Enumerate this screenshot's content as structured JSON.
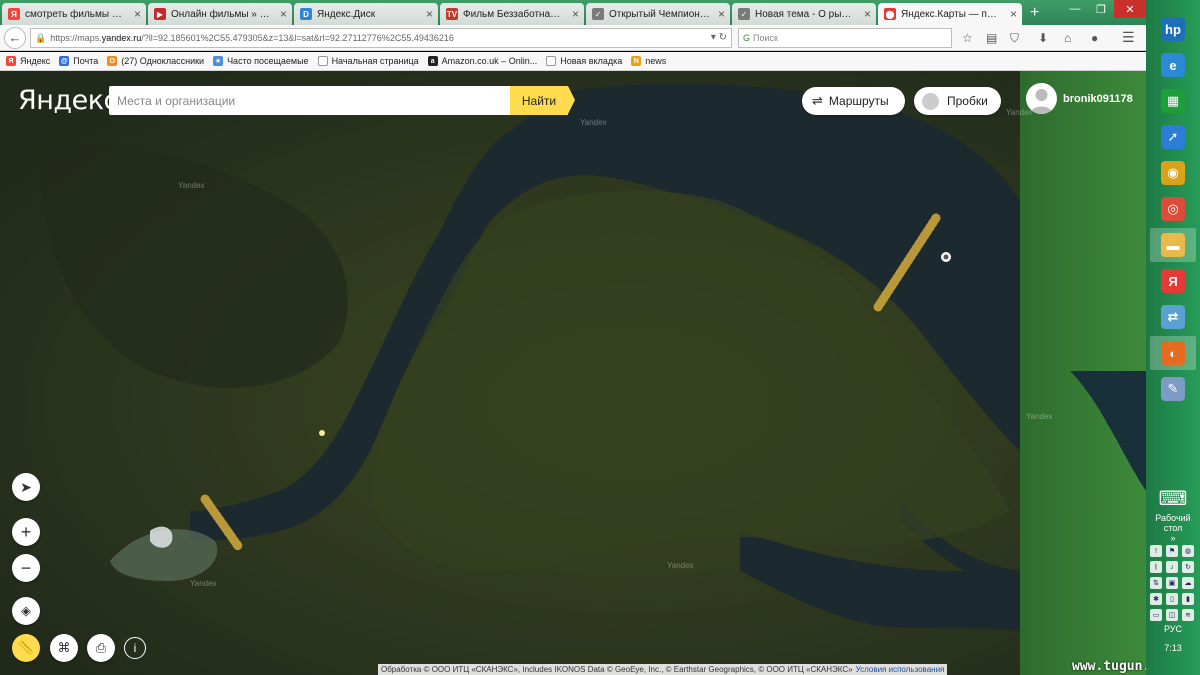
{
  "browser": {
    "tabs": [
      {
        "title": "смотреть фильмы он...",
        "icon": "yandex-video-icon",
        "color": "#f0453a",
        "glyph": "Я"
      },
      {
        "title": "Онлайн фильмы » Ст...",
        "icon": "film-icon",
        "color": "#c22b2b",
        "glyph": "▶"
      },
      {
        "title": "Яндекс.Диск",
        "icon": "yandex-disk-icon",
        "color": "#2f86d6",
        "glyph": "D"
      },
      {
        "title": "Фильм Беззаботная (...",
        "icon": "tv-icon",
        "color": "#c0392b",
        "glyph": "TV"
      },
      {
        "title": "Открытый Чемпионат...",
        "icon": "forum-icon",
        "color": "#7a7a7a",
        "glyph": "✓"
      },
      {
        "title": "Новая тема - О рыбал...",
        "icon": "forum-icon",
        "color": "#7a7a7a",
        "glyph": "✓"
      },
      {
        "title": "Яндекс.Карты — подр...",
        "icon": "yandex-maps-icon",
        "color": "#e53935",
        "glyph": "⬤"
      }
    ],
    "new_tab": "+",
    "url_prefix": "https://maps.",
    "url_host": "yandex.ru",
    "url_rest": "/?ll=92.185601%2C55.479305&z=13&l=sat&rl=92.27112776%2C55.49436216",
    "search_placeholder": "Поиск",
    "bookmarks": [
      {
        "label": "Яндекс",
        "icon": "yandex-icon",
        "color": "#f0453a",
        "glyph": "Я"
      },
      {
        "label": "Почта",
        "icon": "mail-icon",
        "color": "#2f6fd6",
        "glyph": "@"
      },
      {
        "label": "(27) Одноклассники",
        "icon": "ok-icon",
        "color": "#f28c1c",
        "glyph": "O"
      },
      {
        "label": "Часто посещаемые",
        "icon": "star-folder-icon",
        "color": "#4a90d9",
        "glyph": "★"
      },
      {
        "label": "Начальная страница",
        "icon": "page-icon",
        "color": "#ffffff",
        "glyph": ""
      },
      {
        "label": "Amazon.co.uk – Onlin...",
        "icon": "amazon-icon",
        "color": "#222222",
        "glyph": "a"
      },
      {
        "label": "Новая вкладка",
        "icon": "page-icon",
        "color": "#ffffff",
        "glyph": ""
      },
      {
        "label": "news",
        "icon": "rss-folder-icon",
        "color": "#e8a21a",
        "glyph": "N"
      }
    ]
  },
  "maps": {
    "logo": "Яндекс",
    "search_placeholder": "Места и организации",
    "find_label": "Найти",
    "routes_label": "Маршруты",
    "traffic_label": "Пробки",
    "username": "bronik091178",
    "watermarks": [
      "Yandex",
      "Yandex",
      "Yandex",
      "Yandex",
      "Yandex",
      "Yandex"
    ],
    "copyright": "Обработка © ООО ИТЦ «СКАНЭКС», Includes IKONOS Data © GeoEye, Inc., © Earthstar Geographics, © ООО ИТЦ «СКАНЭКС»",
    "terms_link": "Условия использования",
    "site_watermark": "www.tugun.ru",
    "colors": {
      "find": "#ffdb4d",
      "route_marker": "#c9a53a",
      "water": "#1c2a30"
    }
  },
  "taskbar": {
    "icons": [
      {
        "name": "hp-icon",
        "glyph": "hp",
        "color": "#1d6fb8"
      },
      {
        "name": "ie-icon",
        "glyph": "e",
        "color": "#2a8ad4"
      },
      {
        "name": "store-icon",
        "glyph": "▦",
        "color": "#1e9e3a"
      },
      {
        "name": "rocket-icon",
        "glyph": "➚",
        "color": "#2b7dd6"
      },
      {
        "name": "media-icon",
        "glyph": "◉",
        "color": "#d8a21a"
      },
      {
        "name": "chrome-icon",
        "glyph": "◎",
        "color": "#dd4b39"
      },
      {
        "name": "explorer-icon",
        "glyph": "▬",
        "color": "#e9b94a"
      },
      {
        "name": "yandex-browser-icon",
        "glyph": "Я",
        "color": "#e53935"
      },
      {
        "name": "network-icon",
        "glyph": "⇄",
        "color": "#5aa0d0"
      },
      {
        "name": "firefox-icon",
        "glyph": "◐",
        "color": "#e66a1f"
      },
      {
        "name": "paint-icon",
        "glyph": "✎",
        "color": "#7c9cc6"
      }
    ],
    "keyboard_glyph": "⌨",
    "desktop_label": "Рабочий стол",
    "language": "РУС",
    "time": "7:13"
  }
}
